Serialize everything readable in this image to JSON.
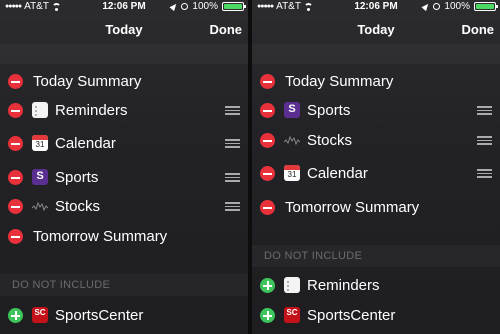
{
  "status": {
    "carrier": "AT&T",
    "time": "12:06 PM",
    "battery": "100%",
    "battery_level": 1.0
  },
  "nav": {
    "title": "Today",
    "done": "Done"
  },
  "left": {
    "included": [
      {
        "label": "Today Summary"
      },
      {
        "label": "Reminders"
      },
      {
        "label": "Calendar",
        "icon_number": "31"
      },
      {
        "label": "Sports",
        "icon_letter": "S"
      },
      {
        "label": "Stocks"
      },
      {
        "label": "Tomorrow Summary"
      }
    ],
    "section_header": "DO NOT INCLUDE",
    "excluded": [
      {
        "label": "SportsCenter",
        "icon_text": "SC"
      }
    ]
  },
  "right": {
    "included": [
      {
        "label": "Today Summary"
      },
      {
        "label": "Sports",
        "icon_letter": "S"
      },
      {
        "label": "Stocks"
      },
      {
        "label": "Calendar",
        "icon_number": "31"
      },
      {
        "label": "Tomorrow Summary"
      }
    ],
    "section_header": "DO NOT INCLUDE",
    "excluded": [
      {
        "label": "Reminders"
      },
      {
        "label": "SportsCenter",
        "icon_text": "SC"
      }
    ]
  },
  "colors": {
    "remove": "#e8313a",
    "add": "#3ec45a",
    "battery": "#4cd964"
  }
}
